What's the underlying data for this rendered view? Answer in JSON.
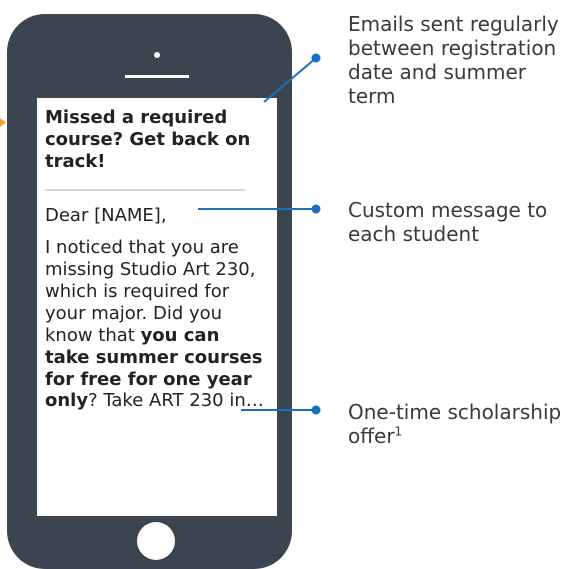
{
  "email": {
    "subject": "Missed a required course? Get back on track!",
    "greeting": "Dear [NAME],",
    "body_intro": "I noticed that you are missing Studio Art 230, which is required for your major. Did you know that ",
    "body_bold": "you can take summer courses for free for one year only",
    "body_after": "?",
    "body_tail": "Take ART 230 in…"
  },
  "callouts": {
    "frequency": "Emails sent regularly between registration date and summer term",
    "custom": "Custom message to each student",
    "scholarship": "One-time scholarship offer",
    "scholarship_footnote": "1"
  },
  "colors": {
    "phone_body": "#3c4450",
    "connector": "#1a6fc0",
    "edge_arrow": "#f0a040"
  }
}
